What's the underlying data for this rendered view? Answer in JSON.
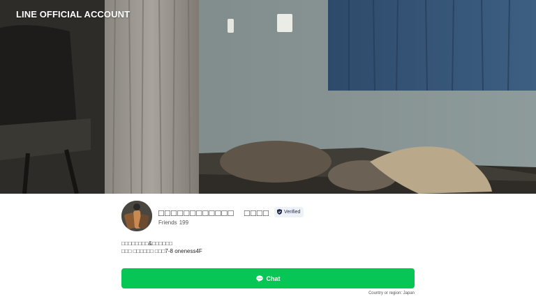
{
  "header": {
    "brand": "LINE OFFICIAL ACCOUNT"
  },
  "cover": {
    "description_icon": "bedroom-cover-photo"
  },
  "profile": {
    "name": "□□□□□□□□□□□□　□□□□",
    "verified_label": "Verified",
    "friends_label": "Friends",
    "friends_count": "199"
  },
  "description": {
    "line1": "□□□□□□□□&□□□□□□",
    "line2": "□□□ □□□□□□ □□□7-8 oneness4F"
  },
  "actions": {
    "chat_label": "Chat"
  },
  "footer": {
    "country": "Country or region: Japan"
  },
  "colors": {
    "accent": "#06c755",
    "brand_text": "#ffffff",
    "badge_bg": "#eef1f8"
  }
}
